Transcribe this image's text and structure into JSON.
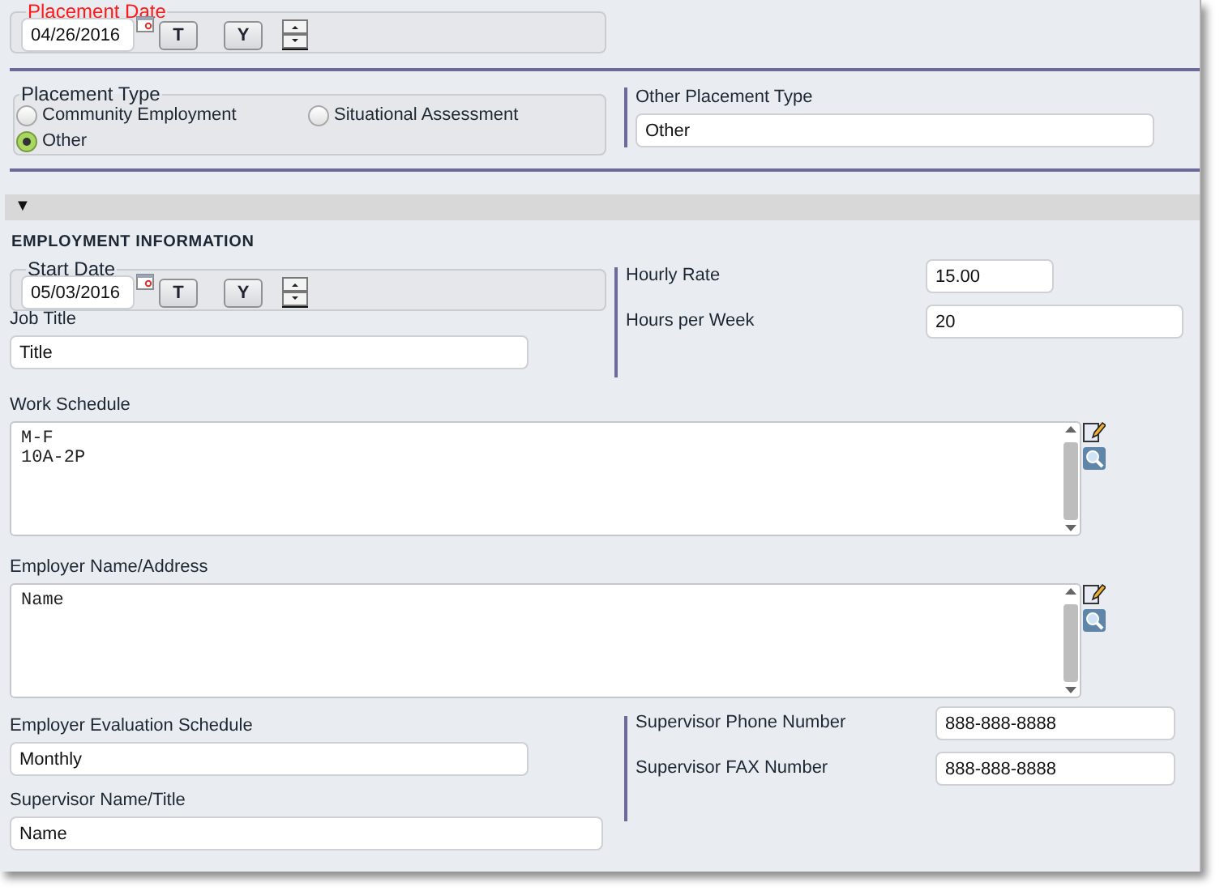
{
  "placement_date": {
    "legend": "Placement Date",
    "value": "04/26/2016",
    "buttons": [
      "T",
      "Y"
    ]
  },
  "placement_type": {
    "legend": "Placement Type",
    "options": [
      {
        "label": "Community Employment",
        "selected": false
      },
      {
        "label": "Situational Assessment",
        "selected": false
      },
      {
        "label": "Other",
        "selected": true
      }
    ]
  },
  "other_placement_type": {
    "label": "Other Placement Type",
    "value": "Other"
  },
  "section": {
    "toggle": "▼",
    "title": "EMPLOYMENT INFORMATION"
  },
  "start_date": {
    "legend": "Start Date",
    "value": "05/03/2016",
    "buttons": [
      "T",
      "Y"
    ]
  },
  "hourly_rate": {
    "label": "Hourly Rate",
    "value": "15.00"
  },
  "hours_per_week": {
    "label": "Hours per Week",
    "value": "20"
  },
  "job_title": {
    "label": "Job Title",
    "value": "Title"
  },
  "work_schedule": {
    "label": "Work Schedule",
    "lines": [
      "M-F",
      "10A-2P"
    ]
  },
  "employer_name_address": {
    "label": "Employer Name/Address",
    "lines": [
      "Name"
    ]
  },
  "employer_evaluation_schedule": {
    "label": "Employer Evaluation Schedule",
    "value": "Monthly"
  },
  "supervisor_name_title": {
    "label": "Supervisor Name/Title",
    "value": "Name"
  },
  "supervisor_phone": {
    "label": "Supervisor Phone Number",
    "value": "888-888-8888"
  },
  "supervisor_fax": {
    "label": "Supervisor FAX Number",
    "value": "888-888-8888"
  }
}
